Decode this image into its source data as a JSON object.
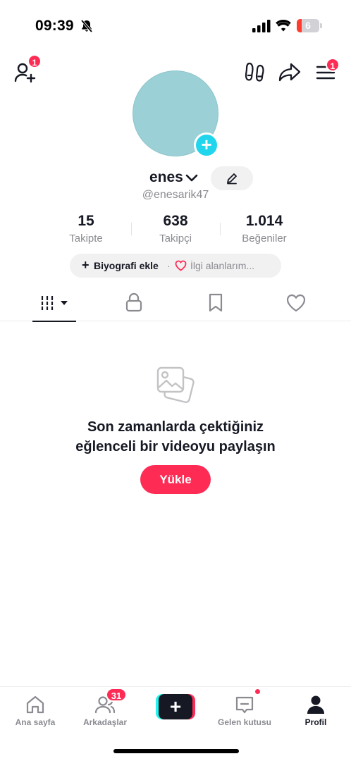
{
  "status_bar": {
    "time": "09:39",
    "battery_level": "6",
    "icons": [
      "bell-slash-icon",
      "signal-icon",
      "wifi-icon",
      "battery-icon"
    ]
  },
  "top_nav": {
    "add_friend_badge": "1",
    "menu_badge": "1",
    "icons": [
      "add-friend-icon",
      "footprint-icon",
      "share-icon",
      "menu-icon"
    ]
  },
  "profile": {
    "username": "enes",
    "handle": "@enesarik47",
    "avatar_color": "#9bd0d6"
  },
  "stats": [
    {
      "value": "15",
      "label": "Takipte"
    },
    {
      "value": "638",
      "label": "Takipçi"
    },
    {
      "value": "1.014",
      "label": "Beğeniler"
    }
  ],
  "bio": {
    "plus": "+",
    "add_bio": "Biyografi ekle",
    "separator": "·",
    "interests": "İlgi alanlarım..."
  },
  "tabs": [
    "videos-grid-icon",
    "lock-icon",
    "bookmark-icon",
    "heart-icon"
  ],
  "empty_state": {
    "title_line1": "Son zamanlarda çektiğiniz",
    "title_line2": "eğlenceli bir videoyu paylaşın",
    "button": "Yükle"
  },
  "bottom_nav": {
    "home": "Ana sayfa",
    "friends": "Arkadaşlar",
    "friends_badge": "31",
    "create": "+",
    "inbox": "Gelen kutusu",
    "profile": "Profil"
  },
  "colors": {
    "accent": "#fe2c55",
    "cyan": "#25f4ee",
    "text": "#161823",
    "muted": "#8a8b91"
  }
}
